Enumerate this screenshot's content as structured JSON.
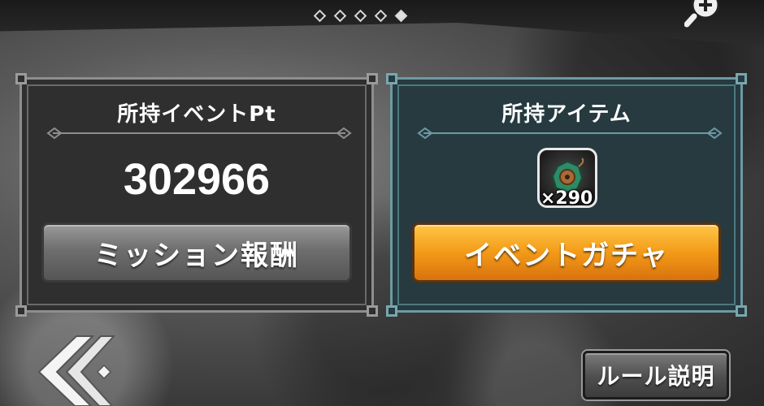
{
  "pager": {
    "count": 5,
    "active_index": 4
  },
  "points_panel": {
    "title": "所持イベントPt",
    "value": "302966",
    "button_label": "ミッション報酬"
  },
  "items_panel": {
    "title": "所持アイテム",
    "item_icon": "jade-medallion-icon",
    "item_count": "×290",
    "button_label": "イベントガチャ"
  },
  "footer": {
    "rules_label": "ルール説明"
  },
  "colors": {
    "accent_orange": "#f39a18",
    "panel_teal": "#263a40",
    "panel_gray": "#2f2f2f"
  }
}
